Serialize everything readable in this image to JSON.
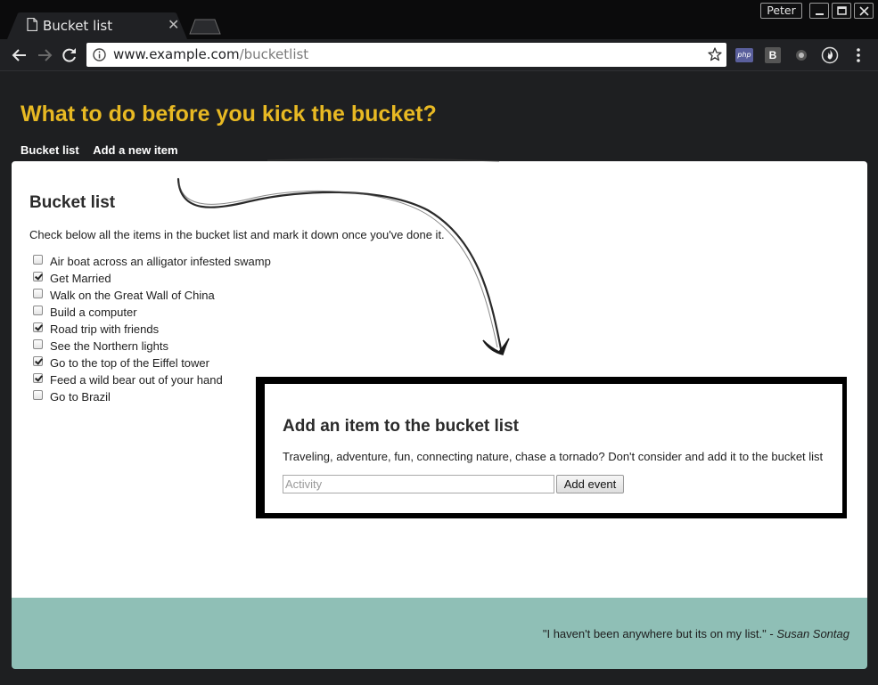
{
  "browser": {
    "tab_title": "Bucket list",
    "profile_name": "Peter",
    "url_host": "www.example.com",
    "url_path": "/bucketlist",
    "extensions": [
      "php-extension-icon",
      "b-extension-icon",
      "c-extension-icon",
      "fire-extension-icon"
    ],
    "ext_php_label": "php",
    "ext_b_label": "B"
  },
  "page": {
    "title": "What to do before you kick the bucket?",
    "nav": [
      "Bucket list",
      "Add a new item"
    ],
    "list_title": "Bucket list",
    "list_description": "Check below all the items in the bucket list and mark it down once you've done it.",
    "items": [
      {
        "label": "Air boat across an alligator infested swamp",
        "checked": false
      },
      {
        "label": "Get Married",
        "checked": true
      },
      {
        "label": "Walk on the Great Wall of China",
        "checked": false
      },
      {
        "label": "Build a computer",
        "checked": false
      },
      {
        "label": "Road trip with friends",
        "checked": true
      },
      {
        "label": "See the Northern lights",
        "checked": false
      },
      {
        "label": "Go to the top of the Eiffel tower",
        "checked": true
      },
      {
        "label": "Feed a wild bear out of your hand",
        "checked": true
      },
      {
        "label": "Go to Brazil",
        "checked": false
      }
    ],
    "add_title": "Add an item to the bucket list",
    "add_description": "Traveling, adventure, fun, connecting nature, chase a tornado? Don't consider and add it to the bucket list",
    "add_placeholder": "Activity",
    "add_button": "Add event",
    "quote_text": "\"I haven't been anywhere but its on my list.\" - ",
    "quote_author": "Susan Sontag"
  },
  "colors": {
    "title": "#e8b923",
    "background": "#1e1f21",
    "footer": "#8fbfb6"
  }
}
